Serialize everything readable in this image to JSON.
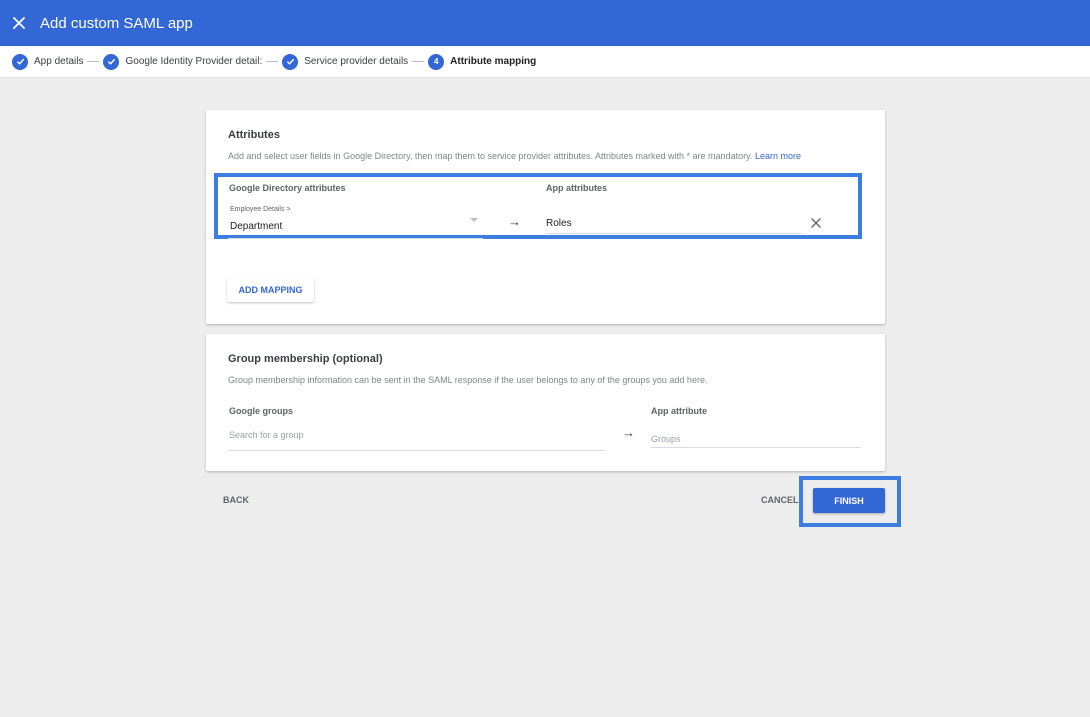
{
  "header": {
    "title": "Add custom SAML app",
    "close_icon": "close-icon"
  },
  "stepper": {
    "steps": [
      {
        "label": "App details",
        "status": "done"
      },
      {
        "label": "Google Identity Provider detail:",
        "status": "done"
      },
      {
        "label": "Service provider details",
        "status": "done"
      },
      {
        "label": "Attribute mapping",
        "status": "active",
        "number": "4"
      }
    ]
  },
  "attributes": {
    "title": "Attributes",
    "description": "Add and select user fields in Google Directory, then map them to service provider attributes. Attributes marked with * are mandatory.",
    "learn_more": "Learn more",
    "google_col_label": "Google Directory attributes",
    "app_col_label": "App attributes",
    "mapping": {
      "category": "Employee Details >",
      "google_field": "Department",
      "app_field": "Roles"
    },
    "arrow": "→",
    "add_mapping_label": "ADD MAPPING"
  },
  "group_membership": {
    "title": "Group membership (optional)",
    "description": "Group membership information can be sent in the SAML response if the user belongs to any of the groups you add here.",
    "google_groups_label": "Google groups",
    "search_placeholder": "Search for a group",
    "app_attribute_label": "App attribute",
    "app_attribute_placeholder": "Groups",
    "arrow": "→"
  },
  "footer": {
    "back_label": "BACK",
    "cancel_label": "CANCEL",
    "finish_label": "FINISH"
  },
  "colors": {
    "brand_blue": "#3367d6",
    "highlight_blue": "#3b7de0",
    "background": "#ededed"
  }
}
